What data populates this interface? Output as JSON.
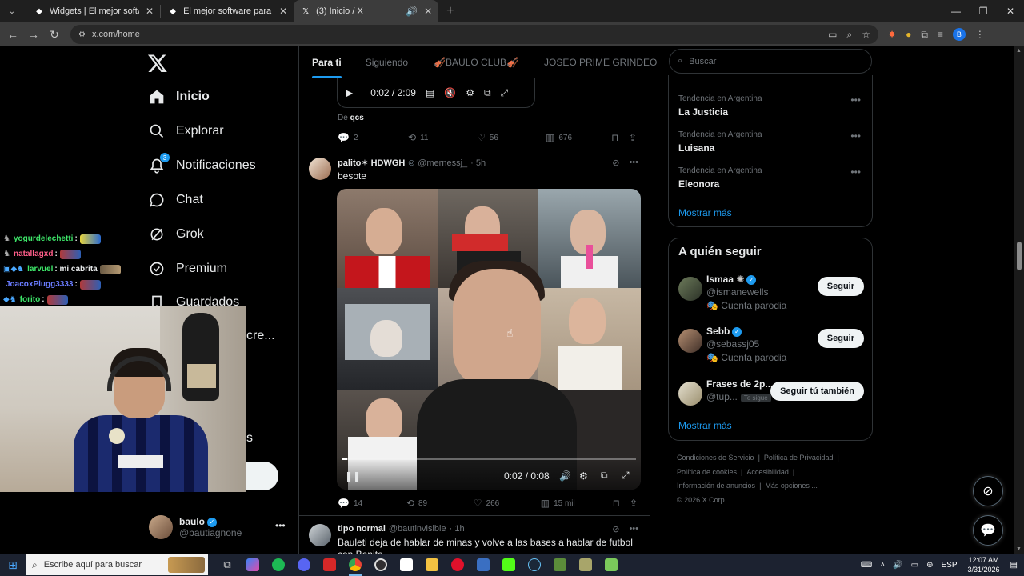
{
  "browser": {
    "tabs": [
      {
        "title": "Widgets | El mejor software pa",
        "favicon": "logo-icon",
        "active": false
      },
      {
        "title": "El mejor software para potenciar",
        "favicon": "logo-icon",
        "active": false
      },
      {
        "title": "(3) Inicio / X",
        "favicon": "x-icon",
        "active": true
      }
    ],
    "url": "x.com/home"
  },
  "sidebar": {
    "items": [
      {
        "label": "Inicio",
        "icon": "home-icon"
      },
      {
        "label": "Explorar",
        "icon": "search-icon"
      },
      {
        "label": "Notificaciones",
        "icon": "bell-icon",
        "badge": "3"
      },
      {
        "label": "Chat",
        "icon": "chat-icon"
      },
      {
        "label": "Grok",
        "icon": "grok-icon"
      },
      {
        "label": "Premium",
        "icon": "premium-icon"
      },
      {
        "label": "Guardados",
        "icon": "bookmark-icon"
      },
      {
        "label": "cre..."
      },
      {
        "label": "s"
      }
    ],
    "account": {
      "name": "baulo",
      "handle": "@bautiagnone"
    }
  },
  "stream_chat": [
    {
      "user": "yogurdelechetti",
      "color": "#3ee86a",
      "text": ":"
    },
    {
      "user": "natallagxd",
      "color": "#3ee86a",
      "text": ":"
    },
    {
      "user": "larvuel",
      "color": "#3ee86a",
      "text": ": mi cabrita"
    },
    {
      "user": "JoacoxPlugg3333",
      "color": "#6a7cff",
      "text": ":"
    },
    {
      "user": "forito",
      "color": "#3ee86a",
      "text": ":"
    }
  ],
  "timeline": {
    "tabs": [
      "Para ti",
      "Siguiendo",
      "🎻BAULO CLUB🎻",
      "JOSEO PRIME GRINDEO"
    ],
    "prev_video_time": "0:02 / 2:09",
    "from_label": "De",
    "from_user": "qcs",
    "prev_stats": {
      "replies": "2",
      "reposts": "11",
      "likes": "56",
      "views": "676"
    },
    "tweet1": {
      "name": "palito✶ HDWGH",
      "handle": "@mernessj_",
      "time": "· 5h",
      "text": "besote",
      "video_time": "0:02 / 0:08",
      "video_progress": 0.02,
      "stats": {
        "replies": "14",
        "reposts": "89",
        "likes": "266",
        "views": "15 mil"
      }
    },
    "tweet2": {
      "name": "tipo normal",
      "handle": "@bautinvisible",
      "time": "· 1h",
      "text": "Bauleti deja de hablar de minas y volve a las bases a hablar de futbol con Benito"
    }
  },
  "right": {
    "search_placeholder": "Buscar",
    "trends": [
      {
        "context": "Tendencia en Argentina",
        "name": "La Justicia"
      },
      {
        "context": "Tendencia en Argentina",
        "name": "Luisana"
      },
      {
        "context": "Tendencia en Argentina",
        "name": "Eleonora"
      }
    ],
    "trends_more": "Mostrar más",
    "who_to_follow_title": "A quién seguir",
    "follow": [
      {
        "name": "Ismaa",
        "handle": "@ismanewells",
        "sub": "Cuenta parodia",
        "button": "Seguir"
      },
      {
        "name": "Sebb",
        "handle": "@sebassj05",
        "sub": "Cuenta parodia",
        "button": "Seguir"
      },
      {
        "name": "Frases de 2p...",
        "handle": "@tup...",
        "tag": "Te sigue",
        "button": "Seguir tú también"
      }
    ],
    "follow_more": "Mostrar más",
    "footer": [
      "Condiciones de Servicio",
      "Política de Privacidad",
      "Política de cookies",
      "Accesibilidad",
      "Información de anuncios",
      "Más opciones ...",
      "© 2026 X Corp."
    ]
  },
  "taskbar": {
    "search_placeholder": "Escribe aquí para buscar",
    "lang": "ESP",
    "time": "12:07 AM",
    "date": "3/31/2026"
  }
}
